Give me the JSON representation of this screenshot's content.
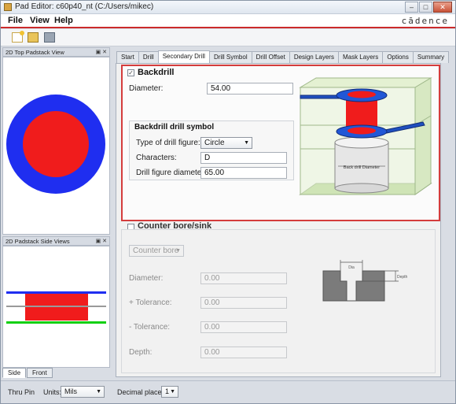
{
  "window": {
    "title": "Pad Editor: c60p40_nt  (C:/Users/mikec)",
    "controls": [
      "–",
      "□",
      "✕"
    ]
  },
  "menu": {
    "items": [
      "File",
      "View",
      "Help"
    ],
    "brand": "cādence"
  },
  "toolbar": {
    "icons": [
      "new-icon",
      "open-icon",
      "save-icon"
    ]
  },
  "left": {
    "top_view_title": "2D Top Padstack View",
    "side_view_title": "2D Padstack Side Views",
    "dock_controls": "▣ ✕",
    "tabs": [
      "Side",
      "Front"
    ],
    "active_tab": "Side"
  },
  "tabs": {
    "items": [
      "Start",
      "Drill",
      "Secondary Drill",
      "Drill Symbol",
      "Drill Offset",
      "Design Layers",
      "Mask Layers",
      "Options",
      "Summary"
    ],
    "active": "Secondary Drill"
  },
  "backdrill": {
    "checkbox_label": "Backdrill",
    "checked": true,
    "diameter_label": "Diameter:",
    "diameter_value": "54.00",
    "symbol_group_title": "Backdrill drill symbol",
    "type_label": "Type of drill figure:",
    "type_value": "Circle",
    "characters_label": "Characters:",
    "characters_value": "D",
    "figure_diameter_label": "Drill figure diameter:",
    "figure_diameter_value": "65.00",
    "illustration_label": "Back drill Diameter"
  },
  "counterbore": {
    "checkbox_label": "Counter bore/sink",
    "checked": false,
    "type_value": "Counter bore",
    "fields": [
      {
        "label": "Diameter:",
        "value": "0.00"
      },
      {
        "label": "+ Tolerance:",
        "value": "0.00"
      },
      {
        "label": "- Tolerance:",
        "value": "0.00"
      },
      {
        "label": "Depth:",
        "value": "0.00"
      }
    ],
    "dia_label": "Dia",
    "depth_label": "Depth"
  },
  "status": {
    "pin_type": "Thru Pin",
    "units_label": "Units:",
    "units_value": "Mils",
    "decimal_label": "Decimal places:",
    "decimal_value": "1"
  },
  "colors": {
    "accent_red": "#cc2b2b",
    "pad_blue": "#1f2ef0",
    "drill_red": "#f01c1c",
    "green_layer": "#12d012"
  }
}
